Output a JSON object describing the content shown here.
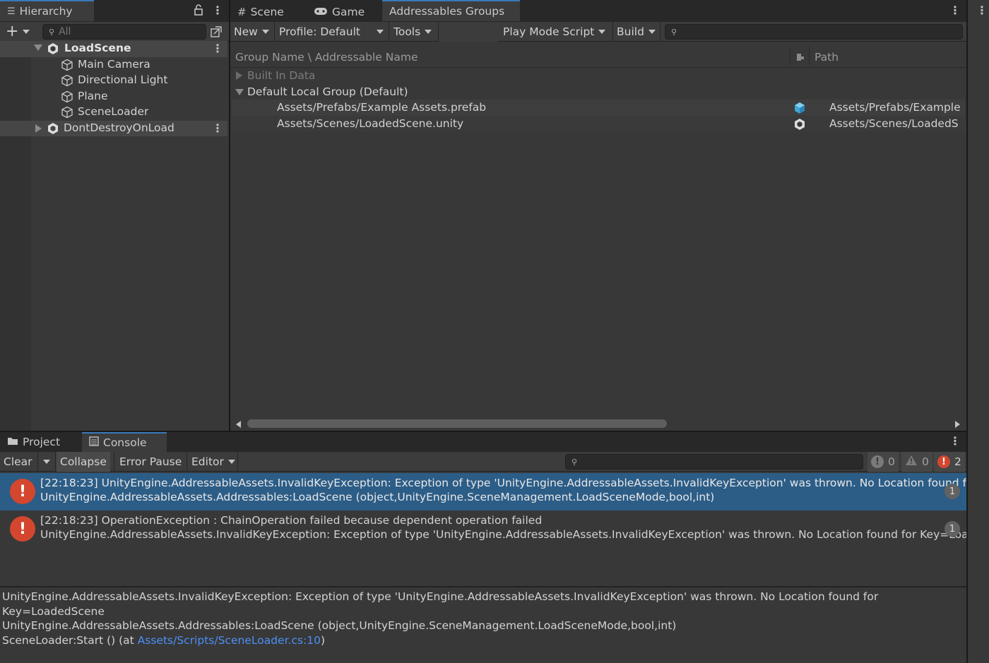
{
  "hierarchy": {
    "tab_label": "Hierarchy",
    "search_placeholder": "All",
    "items": [
      {
        "label": "LoadScene",
        "type": "scene"
      },
      {
        "label": "Main Camera",
        "type": "object"
      },
      {
        "label": "Directional Light",
        "type": "object"
      },
      {
        "label": "Plane",
        "type": "object"
      },
      {
        "label": "SceneLoader",
        "type": "object"
      },
      {
        "label": "DontDestroyOnLoad",
        "type": "scene"
      }
    ]
  },
  "center_tabs": {
    "scene": "Scene",
    "game": "Game",
    "addressables": "Addressables Groups"
  },
  "addressables": {
    "toolbar": {
      "new": "New",
      "profile": "Profile: Default",
      "tools": "Tools",
      "play_mode": "Play Mode Script",
      "build": "Build"
    },
    "columns": {
      "name": "Group Name \\ Addressable Name",
      "path": "Path"
    },
    "groups": [
      {
        "label": "Built In Data"
      },
      {
        "label": "Default Local Group (Default)"
      }
    ],
    "entries": [
      {
        "name": "Assets/Prefabs/Example Assets.prefab",
        "path": "Assets/Prefabs/Example",
        "icon": "prefab-icon"
      },
      {
        "name": "Assets/Scenes/LoadedScene.unity",
        "path": "Assets/Scenes/LoadedS",
        "icon": "scene-icon"
      }
    ]
  },
  "bottom_tabs": {
    "project": "Project",
    "console": "Console"
  },
  "console": {
    "toolbar": {
      "clear": "Clear",
      "collapse": "Collapse",
      "error_pause": "Error Pause",
      "editor": "Editor"
    },
    "counts": {
      "info": "0",
      "warning": "0",
      "error": "2"
    },
    "entries": [
      {
        "line1": "[22:18:23] UnityEngine.AddressableAssets.InvalidKeyException: Exception of type 'UnityEngine.AddressableAssets.InvalidKeyException' was thrown. No Location found for Key=LoadedScene",
        "line2": "UnityEngine.AddressableAssets.Addressables:LoadScene (object,UnityEngine.SceneManagement.LoadSceneMode,bool,int)",
        "count": "1"
      },
      {
        "line1": "[22:18:23] OperationException : ChainOperation failed because dependent operation failed",
        "line2": "UnityEngine.AddressableAssets.InvalidKeyException: Exception of type 'UnityEngine.AddressableAssets.InvalidKeyException' was thrown. No Location found for Key=LoadedScene",
        "count": "1"
      }
    ],
    "detail": {
      "line1": "UnityEngine.AddressableAssets.InvalidKeyException: Exception of type 'UnityEngine.AddressableAssets.InvalidKeyException' was thrown. No Location found for",
      "line2": "Key=LoadedScene",
      "line3": "UnityEngine.AddressableAssets.Addressables:LoadScene (object,UnityEngine.SceneManagement.LoadSceneMode,bool,int)",
      "line4_prefix": "SceneLoader:Start () (at ",
      "line4_link": "Assets/Scripts/SceneLoader.cs:10",
      "line4_suffix": ")"
    }
  },
  "colors": {
    "selection": "#2c5d87",
    "error": "#d4462e",
    "link": "#4c8ff5",
    "panel": "#383838"
  }
}
